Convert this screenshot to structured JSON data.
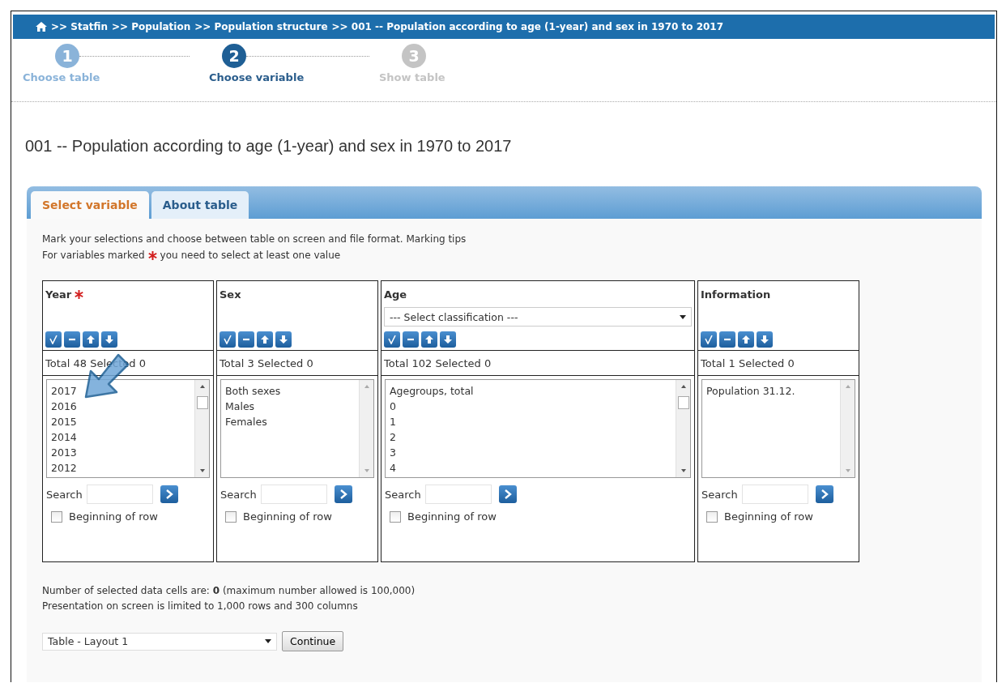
{
  "breadcrumb": {
    "items": [
      ">> Statfin",
      ">> Population",
      ">> Population structure",
      ">> 001 -- Population according to age (1-year) and sex in 1970 to 2017"
    ]
  },
  "steps": [
    {
      "number": "1",
      "label": "Choose table",
      "selected": false,
      "disabled": false
    },
    {
      "number": "2",
      "label": "Choose variable",
      "selected": true,
      "disabled": false
    },
    {
      "number": "3",
      "label": "Show table",
      "selected": false,
      "disabled": true
    }
  ],
  "title": "001 -- Population according to age (1-year) and sex in 1970 to 2017",
  "tabs": [
    {
      "label": "Select variable",
      "selected": true
    },
    {
      "label": "About table",
      "selected": false
    }
  ],
  "intro": [
    "Mark your selections and choose between table on screen and file format. Marking tips",
    "For variables marked",
    "you need to select at least one value"
  ],
  "variables": [
    {
      "name": "Year",
      "required": true,
      "total": "Total 48 Selected 0",
      "items": [
        "2017",
        "2016",
        "2015",
        "2014",
        "2013",
        "2012"
      ],
      "scrollable": true,
      "search_label": "Search",
      "checkbox_label": "Beginning of row",
      "checked": false
    },
    {
      "name": "Sex",
      "required": false,
      "total": "Total 3 Selected 0",
      "items": [
        "Both sexes",
        "Males",
        "Females"
      ],
      "scrollable": false,
      "search_label": "Search",
      "checkbox_label": "Beginning of row",
      "checked": false
    },
    {
      "name": "Age",
      "required": false,
      "classification": "--- Select classification ---",
      "total": "Total 102 Selected 0",
      "items": [
        "Agegroups, total",
        "0",
        "1",
        "2",
        "3",
        "4"
      ],
      "scrollable": true,
      "search_label": "Search",
      "checkbox_label": "Beginning of row",
      "checked": false
    },
    {
      "name": "Information",
      "required": false,
      "total": "Total 1 Selected 0",
      "items": [
        "Population 31.12."
      ],
      "scrollable": false,
      "search_label": "Search",
      "checkbox_label": "Beginning of row",
      "checked": false
    }
  ],
  "summary": [
    "Number of selected data cells are: **0** (maximum number allowed is 100,000)",
    "Presentation on screen is limited to 1,000 rows and 300 columns"
  ],
  "layout_select": "Table - Layout 1",
  "continue_button": "Continue"
}
